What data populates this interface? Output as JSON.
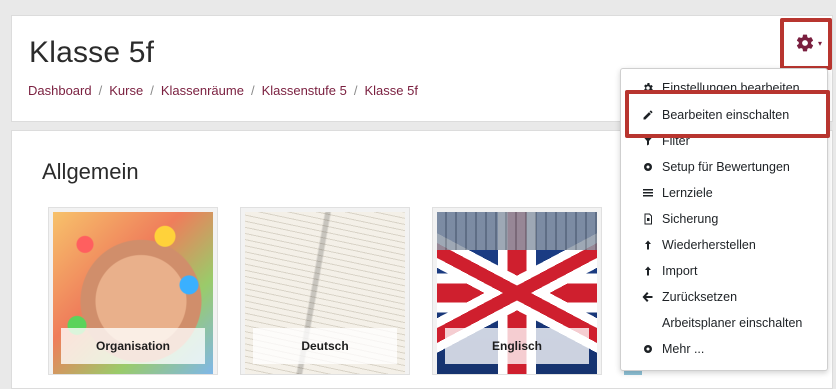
{
  "header": {
    "title": "Klasse 5f",
    "breadcrumb": [
      "Dashboard",
      "Kurse",
      "Klassenräume",
      "Klassenstufe 5",
      "Klasse 5f"
    ],
    "separator": "/"
  },
  "section": {
    "title": "Allgemein",
    "courses": [
      {
        "label": "Organisation",
        "icon": "hands-photo"
      },
      {
        "label": "Deutsch",
        "icon": "book-photo"
      },
      {
        "label": "Englisch",
        "icon": "union-jack-photo"
      }
    ]
  },
  "menu": {
    "caret": "▾",
    "items": [
      {
        "label": "Einstellungen bearbeiten",
        "icon": "gear-icon"
      },
      {
        "label": "Bearbeiten einschalten",
        "icon": "pencil-icon"
      },
      {
        "label": "Filter",
        "icon": "filter-icon"
      },
      {
        "label": "Setup für Bewertungen",
        "icon": "gear-icon"
      },
      {
        "label": "Lernziele",
        "icon": "list-icon"
      },
      {
        "label": "Sicherung",
        "icon": "file-icon"
      },
      {
        "label": "Wiederherstellen",
        "icon": "upload-icon"
      },
      {
        "label": "Import",
        "icon": "upload-icon"
      },
      {
        "label": "Zurücksetzen",
        "icon": "arrow-left-icon"
      },
      {
        "label": "Arbeitsplaner einschalten",
        "icon": ""
      },
      {
        "label": "Mehr ...",
        "icon": "gear-icon"
      }
    ]
  },
  "colors": {
    "accent": "#7a1f3f",
    "highlight": "#b8352f"
  }
}
